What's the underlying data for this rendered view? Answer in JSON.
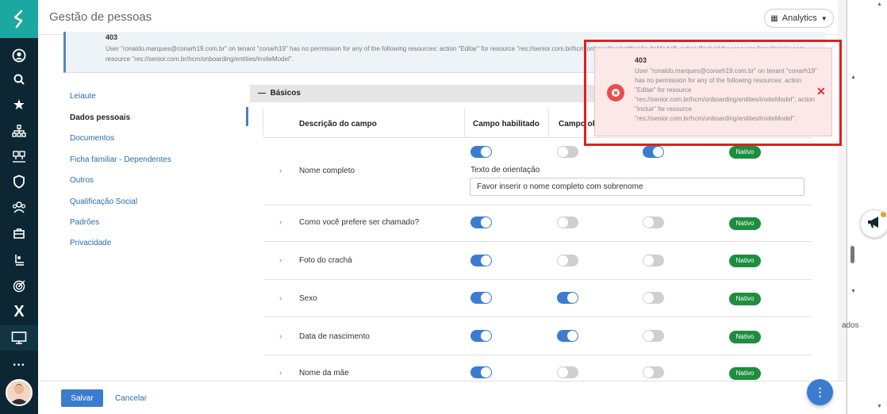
{
  "app": {
    "title": "Gestão de pessoas",
    "analytics_label": "Analytics"
  },
  "colors": {
    "accent": "#3b7cd0",
    "nav_bg": "#0c2733",
    "logo_bg": "#1aa8a0",
    "native_badge": "#1e8e3e",
    "error": "#e84c4c"
  },
  "leftnav": {
    "icons": [
      "logo-icon",
      "user-circle-icon",
      "search-icon",
      "star-icon",
      "org-chart-icon",
      "people-icon",
      "shield-icon",
      "employees-icon",
      "briefcase-icon",
      "person-board-icon",
      "target-icon",
      "x-icon",
      "monitor-icon",
      "more-icon"
    ]
  },
  "banner": {
    "code": "403",
    "message": "User \"ronaldo.marques@conarh19.com.br\" on tenant \"conarh19\" has no permission for any of the following resources: action \"Editar\" for resource \"res://senior.com.br/hcm/onboarding/entities/inviteModel\", action \"Incluir\" for resource \"res://senior.com.br/hcm/onboarding/entities/inviteModel\"",
    "message_line2": "resource \"res://senior.com.br/hcm/onboarding/entities/inviteModel\"."
  },
  "sidemenu": {
    "items": [
      {
        "label": "Leiaute"
      },
      {
        "label": "Dados pessoais"
      },
      {
        "label": "Documentos"
      },
      {
        "label": "Ficha familiar - Dependentes"
      },
      {
        "label": "Outros"
      },
      {
        "label": "Qualificação Social"
      },
      {
        "label": "Padrões"
      },
      {
        "label": "Privacidade"
      }
    ]
  },
  "section": {
    "title": "Básicos",
    "columns": [
      "Descrição do campo",
      "Campo habilitado",
      "Campo ob"
    ],
    "guidance_label": "Texto de orientação",
    "guidance_value": "Favor inserir o nome completo com sobrenome",
    "rows": [
      {
        "label": "Nome completo",
        "enabled": true,
        "required": false,
        "third": true,
        "badge": "Nativo"
      },
      {
        "label": "Como você prefere ser chamado?",
        "enabled": true,
        "required": false,
        "third": false,
        "badge": "Nativo"
      },
      {
        "label": "Foto do crachá",
        "enabled": true,
        "required": false,
        "third": false,
        "badge": "Nativo"
      },
      {
        "label": "Sexo",
        "enabled": true,
        "required": true,
        "third": false,
        "badge": "Nativo"
      },
      {
        "label": "Data de nascimento",
        "enabled": true,
        "required": true,
        "third": false,
        "badge": "Nativo"
      },
      {
        "label": "Nome da mãe",
        "enabled": true,
        "required": false,
        "third": false,
        "badge": "Nativo"
      }
    ]
  },
  "footer": {
    "save_label": "Salvar",
    "cancel_label": "Cancelar"
  },
  "rightpanel": {
    "text": "ados"
  },
  "toast": {
    "code": "403",
    "message": "User \"ronaldo.marques@conarh19.com.br\" on tenant \"conarh19\" has no permission for any of the following resources: action \"Editar\" for resource \"res://senior.com.br/hcm/onboarding/entities/inviteModel\", action \"Incluir\" for resource \"res://senior.com.br/hcm/onboarding/entities/inviteModel\"."
  }
}
